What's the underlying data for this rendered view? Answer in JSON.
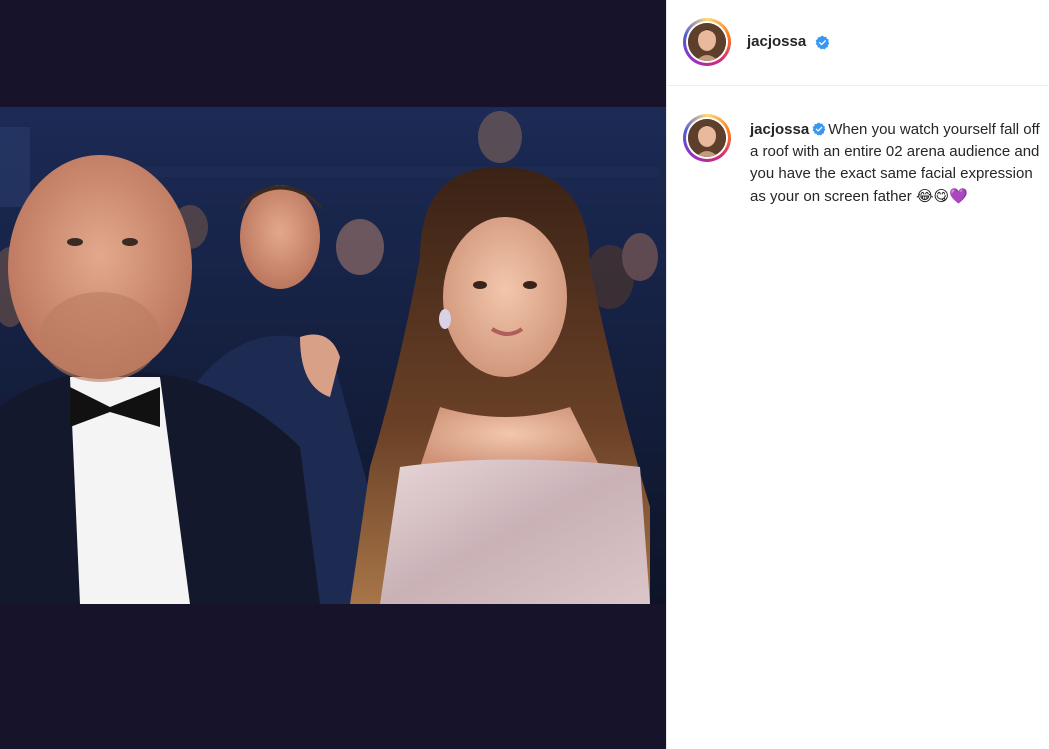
{
  "post": {
    "author": "jacjossa",
    "verified": true,
    "caption_text": "When you watch yourself fall off a roof with an entire 02 arena audience and you have the exact same facial expression as your on screen father",
    "caption_emojis": "😂😋💜"
  },
  "media": {
    "image_description": "",
    "background_color": "#16132a"
  },
  "colors": {
    "verified_badge": "#3897f0",
    "text": "#262626"
  }
}
